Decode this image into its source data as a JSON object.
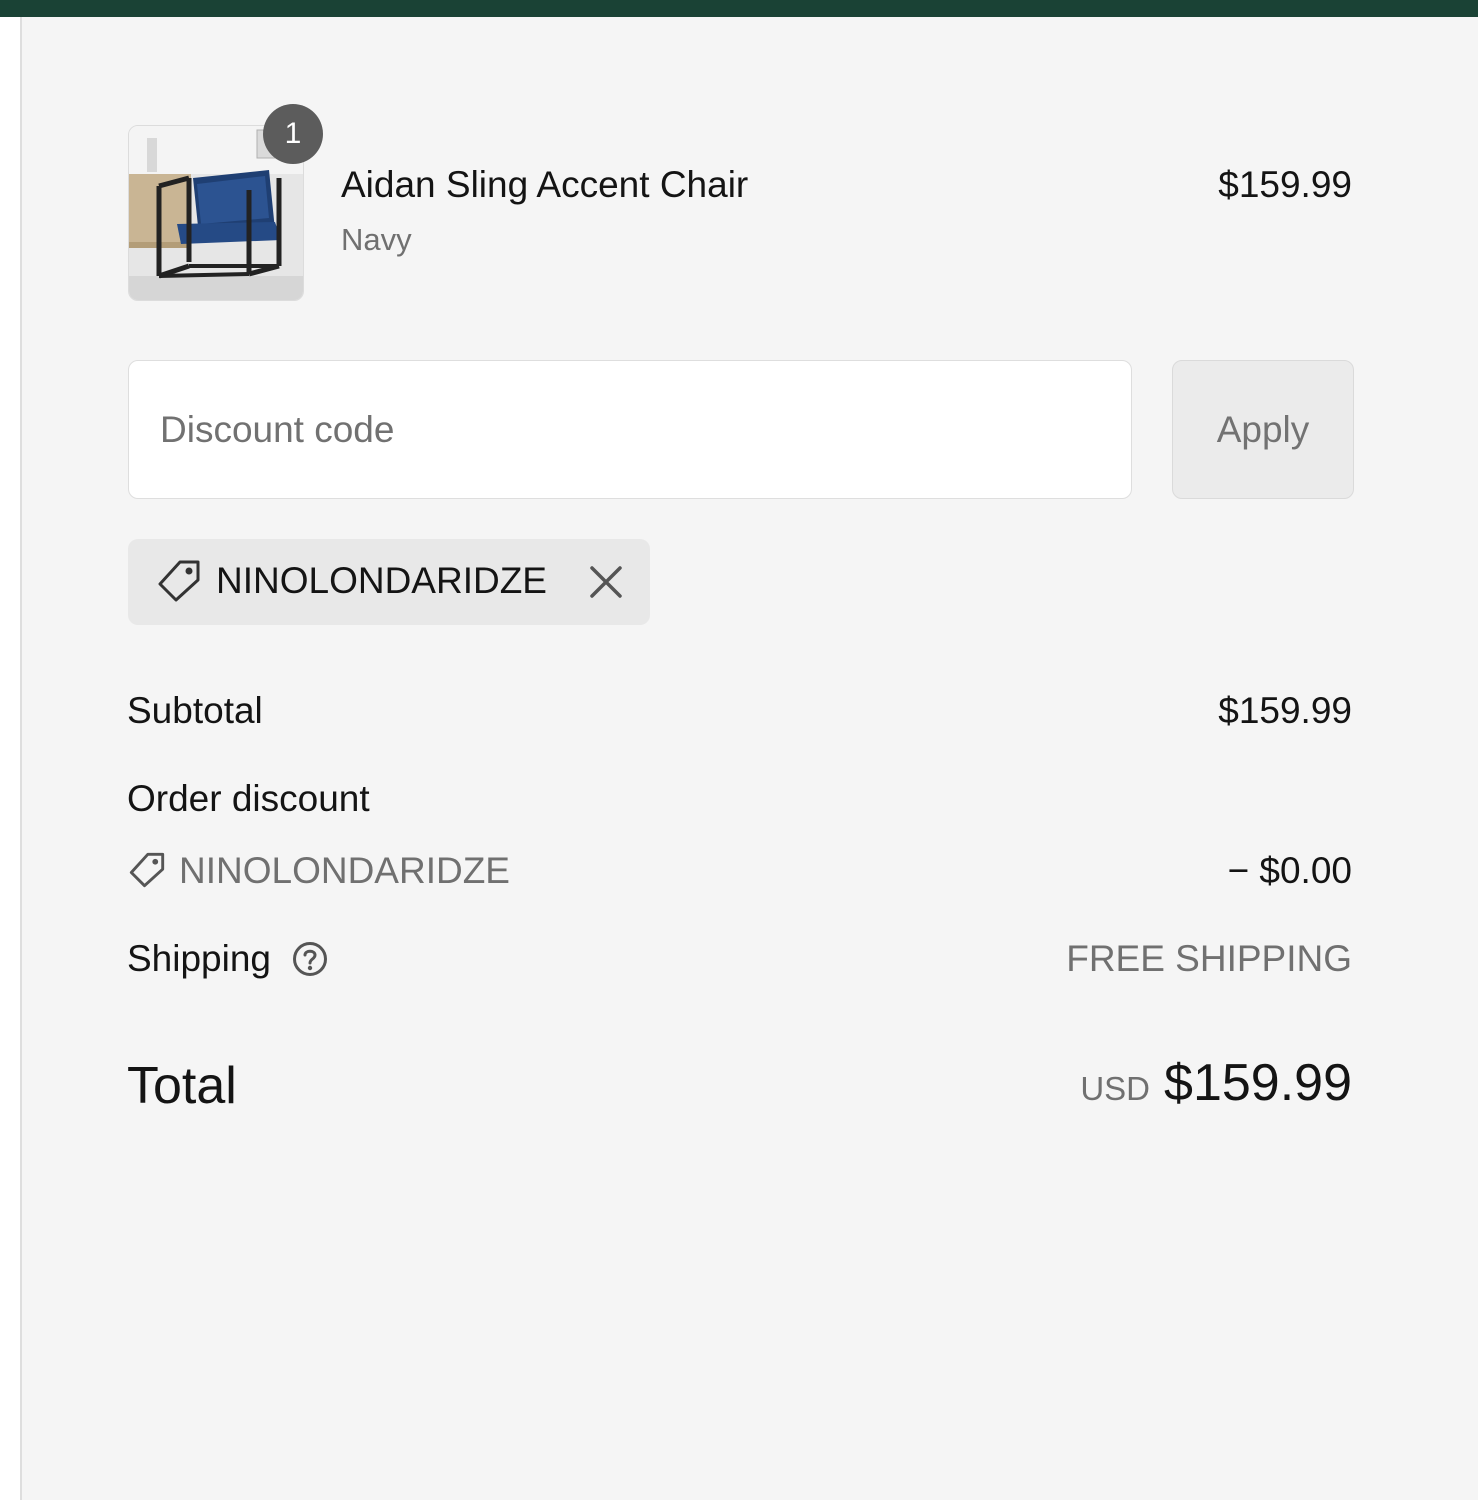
{
  "product": {
    "name": "Aidan Sling Accent Chair",
    "variant": "Navy",
    "price": "$159.99",
    "quantity": "1",
    "image_icon": "chair-product-image"
  },
  "discount": {
    "placeholder": "Discount code",
    "apply_label": "Apply",
    "applied_code": "NINOLONDARIDZE"
  },
  "summary": {
    "subtotal_label": "Subtotal",
    "subtotal_value": "$159.99",
    "order_discount_label": "Order discount",
    "order_discount_code": "NINOLONDARIDZE",
    "order_discount_value": "− $0.00",
    "shipping_label": "Shipping",
    "shipping_value": "FREE SHIPPING",
    "total_label": "Total",
    "total_currency": "USD",
    "total_value": "$159.99"
  },
  "colors": {
    "header_bar": "#1a4235",
    "summary_bg": "#f5f5f5",
    "badge_bg": "#5c5c5c",
    "muted_text": "#707070"
  }
}
